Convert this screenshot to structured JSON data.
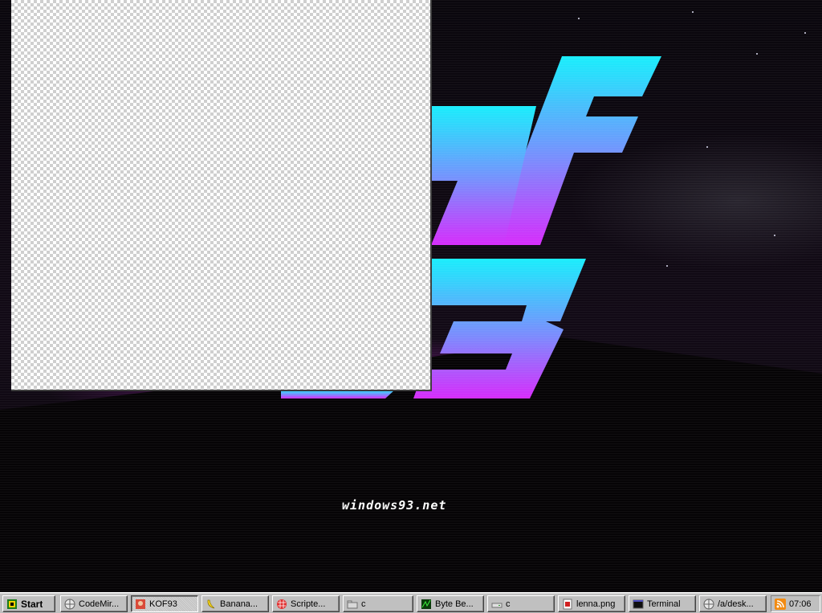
{
  "desktop": {
    "site_text": "windows93.net"
  },
  "taskbar": {
    "start_label": "Start",
    "items": [
      {
        "label": "CodeMir...",
        "icon": "globe-icon"
      },
      {
        "label": "KOF93",
        "icon": "kof-game-icon",
        "active": true
      },
      {
        "label": "Banana...",
        "icon": "banana-icon"
      },
      {
        "label": "Scripte...",
        "icon": "grid-app-icon"
      },
      {
        "label": "c",
        "icon": "folder-icon"
      },
      {
        "label": "Byte Be...",
        "icon": "wave-icon"
      },
      {
        "label": "c",
        "icon": "drive-icon"
      },
      {
        "label": "lenna.png",
        "icon": "image-file-icon"
      },
      {
        "label": "Terminal",
        "icon": "terminal-icon"
      },
      {
        "label": "/a/desk...",
        "icon": "globe-icon"
      }
    ],
    "clock": "07:06",
    "tray_icon": "rss-icon"
  },
  "colors": {
    "logo_top": "#19eefc",
    "logo_bottom": "#d62cfb",
    "taskbar_bg": "#c0c0c0"
  }
}
